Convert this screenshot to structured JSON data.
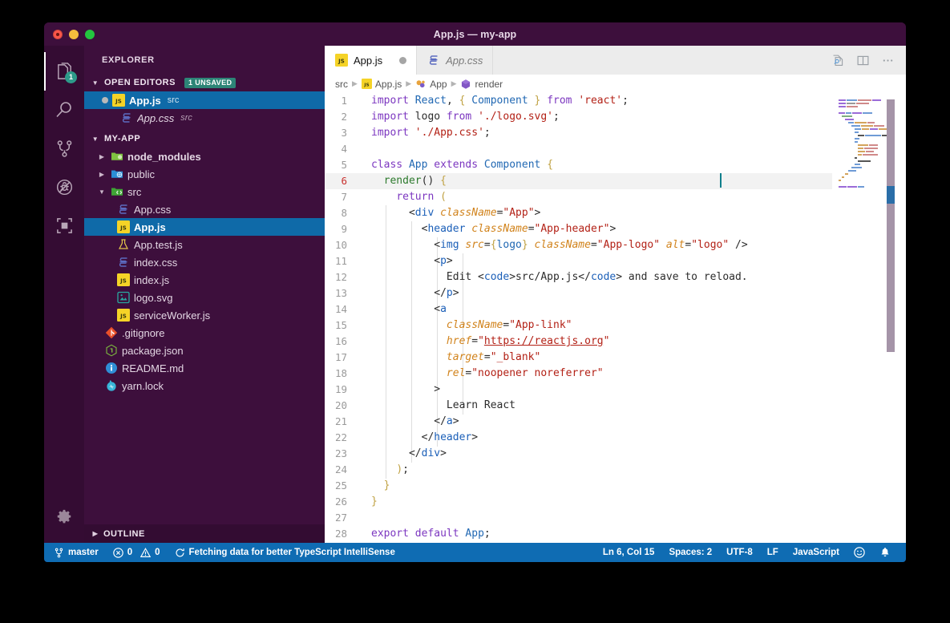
{
  "window": {
    "title": "App.js — my-app",
    "traffic_lights": [
      "close-button",
      "minimize-button",
      "zoom-button"
    ]
  },
  "activity_bar": {
    "items": [
      {
        "name": "explorer",
        "icon": "files-icon",
        "badge": "1",
        "active": true
      },
      {
        "name": "search",
        "icon": "search-icon",
        "badge": "",
        "active": false
      },
      {
        "name": "source-control",
        "icon": "source-control-icon",
        "badge": "",
        "active": false
      },
      {
        "name": "debug",
        "icon": "debug-icon",
        "badge": "",
        "active": false
      },
      {
        "name": "extensions",
        "icon": "extensions-icon",
        "badge": "",
        "active": false
      }
    ],
    "manage": {
      "name": "manage",
      "icon": "gear-icon"
    }
  },
  "sidebar": {
    "title": "EXPLORER",
    "open_editors": {
      "label": "OPEN EDITORS",
      "badge": "1 UNSAVED",
      "items": [
        {
          "name": "App.js",
          "folder": "src",
          "icon": "js-icon",
          "dirty": true,
          "selected": true,
          "italic": false
        },
        {
          "name": "App.css",
          "folder": "src",
          "icon": "css-icon",
          "dirty": false,
          "selected": false,
          "italic": true
        }
      ]
    },
    "project": {
      "label": "MY-APP",
      "items": [
        {
          "name": "node_modules",
          "icon": "folder-node-icon",
          "type": "folder",
          "expanded": false,
          "indent": 1,
          "bold": true
        },
        {
          "name": "public",
          "icon": "folder-public-icon",
          "type": "folder",
          "expanded": false,
          "indent": 1,
          "bold": false
        },
        {
          "name": "src",
          "icon": "folder-src-icon",
          "type": "folder",
          "expanded": true,
          "indent": 1,
          "bold": false
        },
        {
          "name": "App.css",
          "icon": "css-icon",
          "type": "file",
          "indent": 2,
          "bold": false
        },
        {
          "name": "App.js",
          "icon": "js-icon",
          "type": "file",
          "indent": 2,
          "selected": true,
          "bold": true
        },
        {
          "name": "App.test.js",
          "icon": "test-icon",
          "type": "file",
          "indent": 2,
          "bold": false
        },
        {
          "name": "index.css",
          "icon": "css-icon",
          "type": "file",
          "indent": 2,
          "bold": false
        },
        {
          "name": "index.js",
          "icon": "js-icon",
          "type": "file",
          "indent": 2,
          "bold": false
        },
        {
          "name": "logo.svg",
          "icon": "svg-icon",
          "type": "file",
          "indent": 2,
          "bold": false
        },
        {
          "name": "serviceWorker.js",
          "icon": "js-icon",
          "type": "file",
          "indent": 2,
          "bold": false
        },
        {
          "name": ".gitignore",
          "icon": "git-icon",
          "type": "file",
          "indent": 1,
          "bold": false
        },
        {
          "name": "package.json",
          "icon": "npm-icon",
          "type": "file",
          "indent": 1,
          "bold": false
        },
        {
          "name": "README.md",
          "icon": "info-icon",
          "type": "file",
          "indent": 1,
          "bold": false
        },
        {
          "name": "yarn.lock",
          "icon": "yarn-icon",
          "type": "file",
          "indent": 1,
          "bold": false
        }
      ]
    },
    "outline": {
      "label": "OUTLINE"
    }
  },
  "editor": {
    "tabs": [
      {
        "label": "App.js",
        "icon": "js-icon",
        "active": true,
        "dirty": true
      },
      {
        "label": "App.css",
        "icon": "css-icon",
        "active": false,
        "dirty": false
      }
    ],
    "actions": [
      {
        "name": "open-changes",
        "icon": "open-changes-icon"
      },
      {
        "name": "split-editor",
        "icon": "split-editor-icon"
      },
      {
        "name": "more-actions",
        "icon": "ellipsis-icon"
      }
    ],
    "breadcrumb": [
      {
        "label": "src",
        "icon": ""
      },
      {
        "label": "App.js",
        "icon": "js-icon"
      },
      {
        "label": "App",
        "icon": "class-icon"
      },
      {
        "label": "render",
        "icon": "method-icon"
      }
    ],
    "current_line": 6,
    "total_lines": 28,
    "lines": [
      {
        "n": 1,
        "text": "import React, { Component } from 'react';"
      },
      {
        "n": 2,
        "text": "import logo from './logo.svg';"
      },
      {
        "n": 3,
        "text": "import './App.css';"
      },
      {
        "n": 4,
        "text": ""
      },
      {
        "n": 5,
        "text": "class App extends Component {"
      },
      {
        "n": 6,
        "text": "  render() {"
      },
      {
        "n": 7,
        "text": "    return ("
      },
      {
        "n": 8,
        "text": "      <div className=\"App\">"
      },
      {
        "n": 9,
        "text": "        <header className=\"App-header\">"
      },
      {
        "n": 10,
        "text": "          <img src={logo} className=\"App-logo\" alt=\"logo\" />"
      },
      {
        "n": 11,
        "text": "          <p>"
      },
      {
        "n": 12,
        "text": "            Edit <code>src/App.js</code> and save to reload."
      },
      {
        "n": 13,
        "text": "          </p>"
      },
      {
        "n": 14,
        "text": "          <a"
      },
      {
        "n": 15,
        "text": "            className=\"App-link\""
      },
      {
        "n": 16,
        "text": "            href=\"https://reactjs.org\""
      },
      {
        "n": 17,
        "text": "            target=\"_blank\""
      },
      {
        "n": 18,
        "text": "            rel=\"noopener noreferrer\""
      },
      {
        "n": 19,
        "text": "          >"
      },
      {
        "n": 20,
        "text": "            Learn React"
      },
      {
        "n": 21,
        "text": "          </a>"
      },
      {
        "n": 22,
        "text": "        </header>"
      },
      {
        "n": 23,
        "text": "      </div>"
      },
      {
        "n": 24,
        "text": "    );"
      },
      {
        "n": 25,
        "text": "  }"
      },
      {
        "n": 26,
        "text": "}"
      },
      {
        "n": 27,
        "text": ""
      },
      {
        "n": 28,
        "text": "export default App;"
      }
    ]
  },
  "status_bar": {
    "branch": "master",
    "branch_icon": "source-control-icon",
    "errors": "0",
    "error_icon": "error-icon",
    "warnings": "0",
    "warning_icon": "warning-icon",
    "task": "Fetching data for better TypeScript IntelliSense",
    "task_icon": "sync-icon",
    "position": "Ln 6, Col 15",
    "indentation": "Spaces: 2",
    "encoding": "UTF-8",
    "eol": "LF",
    "language": "JavaScript",
    "feedback_icon": "smiley-icon",
    "notifications_icon": "bell-icon"
  },
  "colors": {
    "accent_blue": "#0f6cb3",
    "sidebar_bg": "#3d0f3c",
    "activitybar_bg": "#340c33",
    "selection_blue": "#0f6aa8",
    "badge_teal": "#2d8577",
    "editor_bg": "#ffffff"
  }
}
